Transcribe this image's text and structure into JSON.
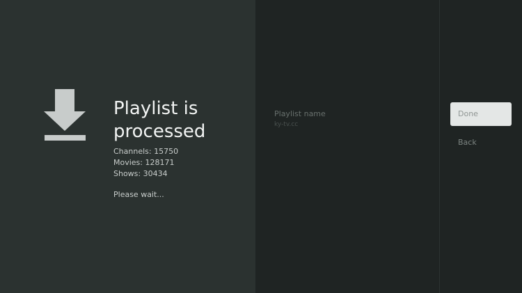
{
  "status": {
    "icon": "download-icon",
    "title": "Playlist is processed",
    "channels": "Channels: 15750",
    "movies": "Movies: 128171",
    "shows": "Shows: 30434",
    "wait_message": "Please wait..."
  },
  "playlist": {
    "name_label": "Playlist name",
    "name_value": "ky-tv.cc"
  },
  "actions": {
    "done_label": "Done",
    "back_label": "Back"
  },
  "colors": {
    "left_panel": "#2b3230",
    "side_panels": "#1f2423",
    "done_button": "#e4e7e6",
    "icon": "#c8cccb"
  }
}
